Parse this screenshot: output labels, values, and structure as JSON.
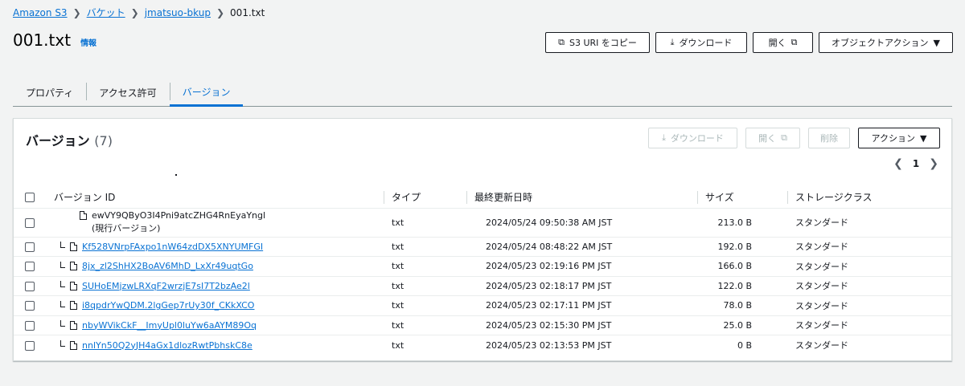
{
  "breadcrumb": {
    "items": [
      "Amazon S3",
      "バケット",
      "jmatsuo-bkup"
    ],
    "current": "001.txt"
  },
  "header": {
    "title": "001.txt",
    "info": "情報",
    "buttons": {
      "copy_uri": "S3 URI をコピー",
      "download": "ダウンロード",
      "open": "開く",
      "object_actions": "オブジェクトアクション"
    }
  },
  "tabs": [
    "プロパティ",
    "アクセス許可",
    "バージョン"
  ],
  "versions": {
    "title": "バージョン",
    "count": "(7)",
    "buttons": {
      "download": "ダウンロード",
      "open": "開く",
      "delete": "削除",
      "actions": "アクション"
    },
    "pager": {
      "page": "1"
    },
    "columns": [
      "バージョン ID",
      "タイプ",
      "最終更新日時",
      "サイズ",
      "ストレージクラス"
    ],
    "current": {
      "id": "ewVY9QByO3I4Pni9atcZHG4RnEyaYngl",
      "label": "(現行バージョン)",
      "type": "txt",
      "modified": "2024/05/24 09:50:38 AM JST",
      "size": "213.0 B",
      "storage": "スタンダード"
    },
    "rows": [
      {
        "id": "Kf528VNrpFAxpo1nW64zdDX5XNYUMFGI",
        "type": "txt",
        "modified": "2024/05/24 08:48:22 AM JST",
        "size": "192.0 B",
        "storage": "スタンダード"
      },
      {
        "id": "8jx_zl2ShHX2BoAV6MhD_LxXr49uqtGo",
        "type": "txt",
        "modified": "2024/05/23 02:19:16 PM JST",
        "size": "166.0 B",
        "storage": "スタンダード"
      },
      {
        "id": "SUHoEMjzwLRXqF2wrzjE7sI7T2bzAe2l",
        "type": "txt",
        "modified": "2024/05/23 02:18:17 PM JST",
        "size": "122.0 B",
        "storage": "スタンダード"
      },
      {
        "id": "i8qpdrYwQDM.2lgGep7rUy30f_CKkXCO",
        "type": "txt",
        "modified": "2024/05/23 02:17:11 PM JST",
        "size": "78.0 B",
        "storage": "スタンダード"
      },
      {
        "id": "nbyWVikCkF__ImyUpl0luYw6aAYM89Oq",
        "type": "txt",
        "modified": "2024/05/23 02:15:30 PM JST",
        "size": "25.0 B",
        "storage": "スタンダード"
      },
      {
        "id": "nnlYn50Q2yJH4aGx1dlozRwtPbhskC8e",
        "type": "txt",
        "modified": "2024/05/23 02:13:53 PM JST",
        "size": "0 B",
        "storage": "スタンダード"
      }
    ]
  },
  "icons": {
    "copy": "copy-icon",
    "download": "download-icon",
    "external": "external-link-icon",
    "caret": "caret-down-icon",
    "file": "file-icon",
    "prev": "chevron-left-icon",
    "next": "chevron-right-icon"
  }
}
